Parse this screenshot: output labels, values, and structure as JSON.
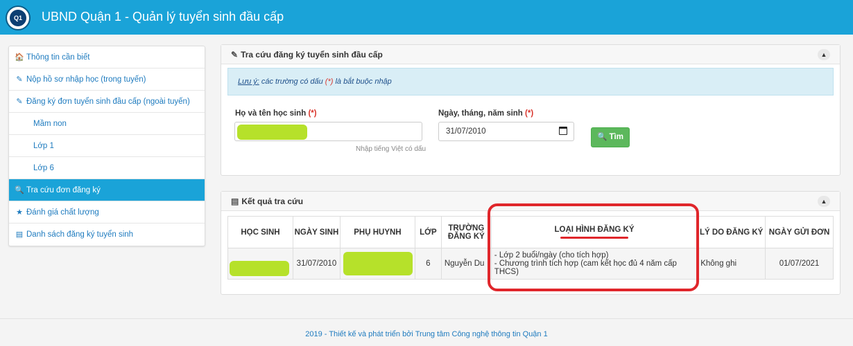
{
  "header": {
    "title": "UBND Quận 1 - Quản lý tuyển sinh đầu cấp",
    "logo_text": "Q1"
  },
  "sidebar": {
    "items": [
      {
        "icon": "home-icon",
        "label": "Thông tin cần biết"
      },
      {
        "icon": "edit-icon",
        "label": "Nộp hồ sơ nhập học (trong tuyến)"
      },
      {
        "icon": "edit-icon",
        "label": "Đăng ký đơn tuyển sinh đầu cấp (ngoài tuyến)"
      },
      {
        "label": "Mầm non"
      },
      {
        "label": "Lớp 1"
      },
      {
        "label": "Lớp 6"
      },
      {
        "icon": "search-icon",
        "label": "Tra cứu đơn đăng ký"
      },
      {
        "icon": "star-icon",
        "label": "Đánh giá chất lượng"
      },
      {
        "icon": "list-icon",
        "label": "Danh sách đăng ký tuyển sinh"
      }
    ]
  },
  "search_panel": {
    "title": "Tra cứu đăng ký tuyển sinh đầu cấp",
    "note_prefix": "Lưu ý:",
    "note_text": " các trường có dấu ",
    "note_marker": "(*)",
    "note_suffix": " là bắt buộc nhập",
    "name_label": "Họ và tên học sinh",
    "dob_label": "Ngày, tháng, năm sinh",
    "required_mark": "(*)",
    "name_hint": "Nhập tiếng Việt có dấu",
    "dob_value": "31/07/2010",
    "search_label": "Tìm"
  },
  "result_panel": {
    "title": "Kết quả tra cứu",
    "columns": [
      "HỌC SINH",
      "NGÀY SINH",
      "PHỤ HUYNH",
      "LỚP",
      "TRƯỜNG ĐĂNG KÝ",
      "LOẠI HÌNH ĐĂNG KÝ",
      "LÝ DO ĐĂNG KÝ",
      "NGÀY GỬI ĐƠN"
    ],
    "row": {
      "dob": "31/07/2010",
      "grade": "6",
      "school": "Nguyễn Du",
      "type_line1": "- Lớp 2 buổi/ngày (cho tích hợp)",
      "type_line2": "- Chương trình tích hợp (cam kết học đủ 4 năm cấp THCS)",
      "reason": "Không ghi",
      "sent_date": "01/07/2021"
    }
  },
  "footer": {
    "text": "2019 - Thiết kế và phát triển bởi Trung tâm Công nghệ thông tin Quận 1"
  },
  "colors": {
    "header": "#1aa3d8",
    "active": "#1aa3d8",
    "button": "#5cb85c",
    "highlight": "#e0262b",
    "masked": "#b6e12a"
  }
}
